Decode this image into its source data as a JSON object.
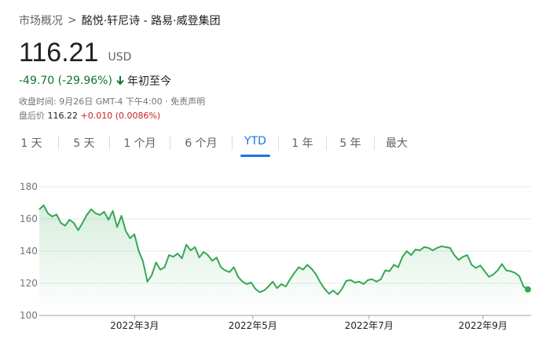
{
  "breadcrumb": {
    "root": "市场概况",
    "separator": ">",
    "name": "酩悦·轩尼诗 - 路易·威登集团"
  },
  "quote": {
    "price": "116.21",
    "currency": "USD",
    "change": "-49.70 (-29.96%)",
    "period_label": "年初至今",
    "close_time": "收盘时间: 9月26日 GMT-4 下午4:00 · 免责声明",
    "after_hours_label": "盘后价",
    "after_hours_value": "116.22",
    "after_hours_change": "+0.010 (0.0086%)"
  },
  "tabs": [
    {
      "label": "1 天"
    },
    {
      "label": "5 天"
    },
    {
      "label": "1 个月"
    },
    {
      "label": "6 个月"
    },
    {
      "label": "YTD",
      "active": true
    },
    {
      "label": "1 年"
    },
    {
      "label": "5 年"
    },
    {
      "label": "最大"
    }
  ],
  "colors": {
    "line": "#34a853",
    "accent": "#1a73e8",
    "negative": "#137333",
    "after_hours": "#c5221f"
  },
  "icons": {
    "change_direction": "arrow-down-icon"
  },
  "chart_data": {
    "type": "area",
    "ylim": [
      100,
      180
    ],
    "yticks": [
      180,
      160,
      140,
      120,
      100
    ],
    "xticks": [
      {
        "label": "2022年3月",
        "t": 0.195
      },
      {
        "label": "2022年5月",
        "t": 0.437
      },
      {
        "label": "2022年7月",
        "t": 0.675
      },
      {
        "label": "2022年9月",
        "t": 0.908
      }
    ],
    "values": [
      165.9,
      168.5,
      163.5,
      161.5,
      162.8,
      157.5,
      155.8,
      159.5,
      157.5,
      153.0,
      157.5,
      162.5,
      166.0,
      163.5,
      162.5,
      164.5,
      159.5,
      165.0,
      155.0,
      162.0,
      152.5,
      148.0,
      150.5,
      140.0,
      133.5,
      121.0,
      125.0,
      133.0,
      128.5,
      130.0,
      137.5,
      136.5,
      138.5,
      135.5,
      144.0,
      140.5,
      142.5,
      136.0,
      139.5,
      137.5,
      134.0,
      136.0,
      130.0,
      128.0,
      127.0,
      130.0,
      124.0,
      121.0,
      119.5,
      120.5,
      116.5,
      114.5,
      115.5,
      118.0,
      121.0,
      117.0,
      119.5,
      118.0,
      122.5,
      126.5,
      130.0,
      128.5,
      131.5,
      129.0,
      125.5,
      120.5,
      116.5,
      113.5,
      115.5,
      113.0,
      116.5,
      121.5,
      122.0,
      120.5,
      121.0,
      119.5,
      122.0,
      122.5,
      121.0,
      122.5,
      128.0,
      127.5,
      131.5,
      130.0,
      136.5,
      140.0,
      137.5,
      141.0,
      140.5,
      142.5,
      142.0,
      140.5,
      142.0,
      143.0,
      142.5,
      142.0,
      137.5,
      134.5,
      136.5,
      137.5,
      131.5,
      129.5,
      131.0,
      127.5,
      124.0,
      125.5,
      128.0,
      132.0,
      128.0,
      127.5,
      126.5,
      124.5,
      118.0,
      116.21
    ]
  }
}
